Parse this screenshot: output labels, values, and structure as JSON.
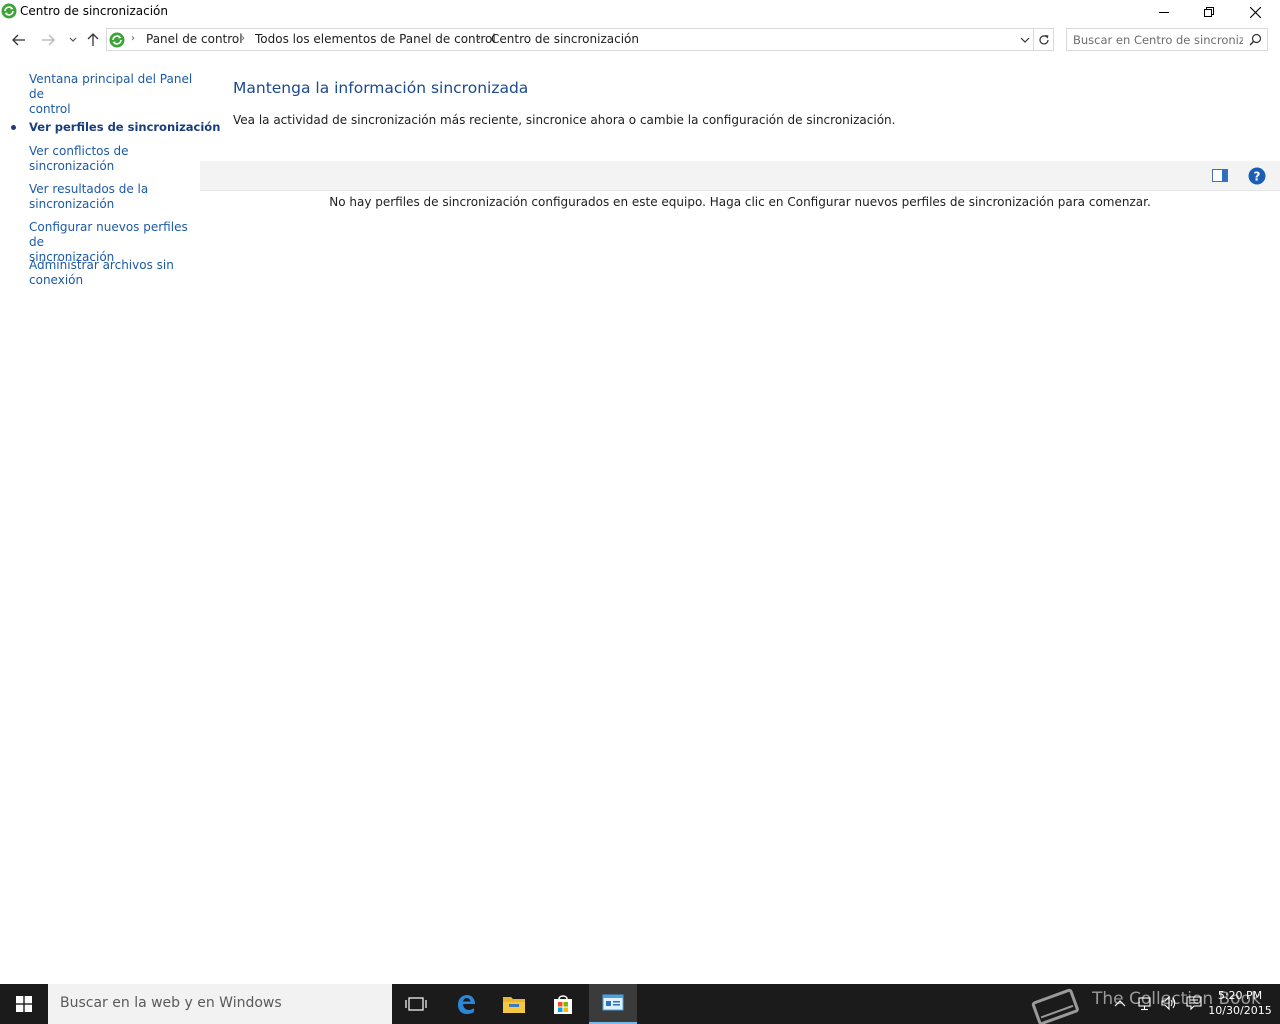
{
  "window": {
    "title": "Centro de sincronización",
    "controls": [
      "minimize",
      "restore",
      "close"
    ]
  },
  "address": {
    "breadcrumb": [
      "Panel de control",
      "Todos los elementos de Panel de control",
      "Centro de sincronización"
    ],
    "search_placeholder": "Buscar en Centro de sincroniz..."
  },
  "sidebar": {
    "items": [
      {
        "label_lines": [
          "Ventana principal del Panel de",
          "control"
        ],
        "active": false
      },
      {
        "label_lines": [
          "Ver perfiles de sincronización"
        ],
        "active": true
      },
      {
        "label_lines": [
          "Ver conflictos de",
          "sincronización"
        ],
        "active": false
      },
      {
        "label_lines": [
          "Ver resultados de la",
          "sincronización"
        ],
        "active": false
      },
      {
        "label_lines": [
          "Configurar nuevos perfiles de",
          "sincronización"
        ],
        "active": false
      },
      {
        "label_lines": [
          "Administrar archivos sin",
          "conexión"
        ],
        "active": false
      }
    ]
  },
  "main": {
    "title": "Mantenga la información sincronizada",
    "description": "Vea la actividad de sincronización más reciente, sincronice ahora o cambie la configuración de sincronización.",
    "empty_message": "No hay perfiles de sincronización configurados en este equipo. Haga clic en Configurar nuevos perfiles de sincronización para comenzar."
  },
  "taskbar": {
    "search_text": "Buscar en la web y en Windows",
    "watermark": "The Collection Book",
    "time": "5:20 PM",
    "date": "10/30/2015"
  },
  "colors": {
    "link": "#1c5aa6",
    "title": "#1c4a8e",
    "taskbar": "#1b1b1b",
    "help": "#1a5fb4"
  }
}
